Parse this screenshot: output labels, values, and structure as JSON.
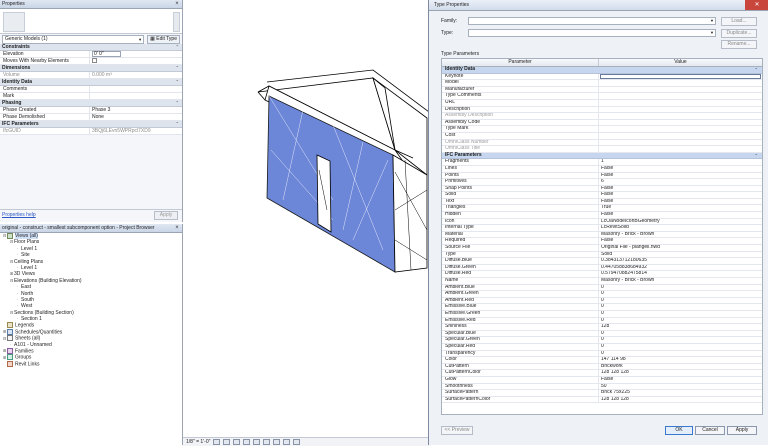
{
  "properties": {
    "title": "Properties",
    "type_selector": "Generic Models (1)",
    "edit_type": "Edit Type",
    "sections": [
      {
        "name": "Constraints",
        "rows": [
          {
            "label": "Elevation",
            "value": "0' 0\"",
            "kind": "input"
          },
          {
            "label": "Moves With Nearby Elements",
            "value": "",
            "kind": "checkbox"
          }
        ]
      },
      {
        "name": "Dimensions",
        "rows": [
          {
            "label": "Volume",
            "value": "0.000 m³",
            "kind": "readonly"
          }
        ]
      },
      {
        "name": "Identity Data",
        "rows": [
          {
            "label": "Comments",
            "value": "",
            "kind": "text"
          },
          {
            "label": "Mark",
            "value": "",
            "kind": "text"
          }
        ]
      },
      {
        "name": "Phasing",
        "rows": [
          {
            "label": "Phase Created",
            "value": "Phase 3",
            "kind": "text"
          },
          {
            "label": "Phase Demolished",
            "value": "None",
            "kind": "text"
          }
        ]
      },
      {
        "name": "IFC Parameters",
        "rows": [
          {
            "label": "IfcGUID",
            "value": "3BQj6LEvn5WPRpcl7XD9",
            "kind": "readonly"
          }
        ]
      }
    ],
    "help_link": "Properties help",
    "apply": "Apply"
  },
  "browser": {
    "title": "original - construct - smallest subcomponent option - Project Browser",
    "items": [
      {
        "label": "Views (all)",
        "depth": 0,
        "toggle": "⊟",
        "icon": "views",
        "selected": true
      },
      {
        "label": "Floor Plans",
        "depth": 1,
        "toggle": "⊟",
        "icon": ""
      },
      {
        "label": "Level 1",
        "depth": 2,
        "toggle": "",
        "icon": ""
      },
      {
        "label": "Site",
        "depth": 2,
        "toggle": "",
        "icon": ""
      },
      {
        "label": "Ceiling Plans",
        "depth": 1,
        "toggle": "⊟",
        "icon": ""
      },
      {
        "label": "Level 1",
        "depth": 2,
        "toggle": "",
        "icon": ""
      },
      {
        "label": "3D Views",
        "depth": 1,
        "toggle": "⊞",
        "icon": ""
      },
      {
        "label": "Elevations (Building Elevation)",
        "depth": 1,
        "toggle": "⊟",
        "icon": ""
      },
      {
        "label": "East",
        "depth": 2,
        "toggle": "",
        "icon": ""
      },
      {
        "label": "North",
        "depth": 2,
        "toggle": "",
        "icon": ""
      },
      {
        "label": "South",
        "depth": 2,
        "toggle": "",
        "icon": ""
      },
      {
        "label": "West",
        "depth": 2,
        "toggle": "",
        "icon": ""
      },
      {
        "label": "Sections (Building Section)",
        "depth": 1,
        "toggle": "⊟",
        "icon": ""
      },
      {
        "label": "Section 1",
        "depth": 2,
        "toggle": "",
        "icon": ""
      },
      {
        "label": "Legends",
        "depth": 0,
        "toggle": "",
        "icon": "legend"
      },
      {
        "label": "Schedules/Quantities",
        "depth": 0,
        "toggle": "⊞",
        "icon": "sched"
      },
      {
        "label": "Sheets (all)",
        "depth": 0,
        "toggle": "⊟",
        "icon": "sheet"
      },
      {
        "label": "A101 - Unnamed",
        "depth": 1,
        "toggle": "",
        "icon": ""
      },
      {
        "label": "Families",
        "depth": 0,
        "toggle": "⊞",
        "icon": "fam"
      },
      {
        "label": "Groups",
        "depth": 0,
        "toggle": "⊞",
        "icon": "grp"
      },
      {
        "label": "Revit Links",
        "depth": 0,
        "toggle": "",
        "icon": "link"
      }
    ]
  },
  "statusbar": {
    "scale": "1/8\" = 1'-0\""
  },
  "dialog": {
    "title": "Type Properties",
    "family_label": "Family:",
    "type_label": "Type:",
    "load": "Load...",
    "duplicate": "Duplicate...",
    "rename": "Rename...",
    "type_parameters": "Type Parameters",
    "col_parameter": "Parameter",
    "col_value": "Value",
    "sections": [
      {
        "name": "Identity Data",
        "rows": [
          {
            "k": "Keynote",
            "v": "",
            "edit": true
          },
          {
            "k": "Model",
            "v": ""
          },
          {
            "k": "Manufacturer",
            "v": ""
          },
          {
            "k": "Type Comments",
            "v": ""
          },
          {
            "k": "URL",
            "v": ""
          },
          {
            "k": "Description",
            "v": ""
          },
          {
            "k": "Assembly Description",
            "v": "",
            "ro": true
          },
          {
            "k": "Assembly Code",
            "v": ""
          },
          {
            "k": "Type Mark",
            "v": ""
          },
          {
            "k": "Cost",
            "v": ""
          },
          {
            "k": "OmniClass Number",
            "v": "",
            "ro": true
          },
          {
            "k": "OmniClass Title",
            "v": "",
            "ro": true
          }
        ]
      },
      {
        "name": "IFC Parameters",
        "rows": [
          {
            "k": "Fragments",
            "v": "1"
          },
          {
            "k": "Lines",
            "v": "False"
          },
          {
            "k": "Points",
            "v": "False"
          },
          {
            "k": "Primitives",
            "v": "6"
          },
          {
            "k": "Snap Points",
            "v": "False"
          },
          {
            "k": "Solid",
            "v": "False"
          },
          {
            "k": "Text",
            "v": "False"
          },
          {
            "k": "Triangles",
            "v": "True"
          },
          {
            "k": "Hidden",
            "v": "False"
          },
          {
            "k": "Icon",
            "v": "LcOaNodeIconBGeometry"
          },
          {
            "k": "Internal Type",
            "v": "LcRevitSolid"
          },
          {
            "k": "Material",
            "v": "Masonry - Brick - Brown"
          },
          {
            "k": "Required",
            "v": "False"
          },
          {
            "k": "Source File",
            "v": "Original File - piangeli.nwd"
          },
          {
            "k": "Type",
            "v": "Solid"
          },
          {
            "k": "Diffuse.Blue",
            "v": "0.384313712180635"
          },
          {
            "k": "Diffuse.Green",
            "v": "0.447058838684932"
          },
          {
            "k": "Diffuse.Red",
            "v": "0.579470882475814"
          },
          {
            "k": "Name",
            "v": "Masonry - Brick - Brown"
          },
          {
            "k": "Ambient.Blue",
            "v": "0"
          },
          {
            "k": "Ambient.Green",
            "v": "0"
          },
          {
            "k": "Ambient.Red",
            "v": "0"
          },
          {
            "k": "Emissive.Blue",
            "v": "0"
          },
          {
            "k": "Emissive.Green",
            "v": "0"
          },
          {
            "k": "Emissive.Red",
            "v": "0"
          },
          {
            "k": "Shininess",
            "v": "128"
          },
          {
            "k": "Specular.Blue",
            "v": "0"
          },
          {
            "k": "Specular.Green",
            "v": "0"
          },
          {
            "k": "Specular.Red",
            "v": "0"
          },
          {
            "k": "Transparency",
            "v": "0"
          },
          {
            "k": "Color",
            "v": "147 114 98"
          },
          {
            "k": "CutPattern",
            "v": "Brickwork"
          },
          {
            "k": "CutPatternColor",
            "v": "128 128 128"
          },
          {
            "k": "Glow",
            "v": "False"
          },
          {
            "k": "Smoothness",
            "v": "50"
          },
          {
            "k": "SurfacePattern",
            "v": "Brick 75x225"
          },
          {
            "k": "SurfacePatternColor",
            "v": "128 128 128"
          }
        ]
      }
    ],
    "preview": "<< Preview",
    "ok": "OK",
    "cancel": "Cancel",
    "apply": "Apply"
  },
  "colors": {
    "wall_selection": "#6c86d8",
    "accent": "#3a78d0"
  }
}
